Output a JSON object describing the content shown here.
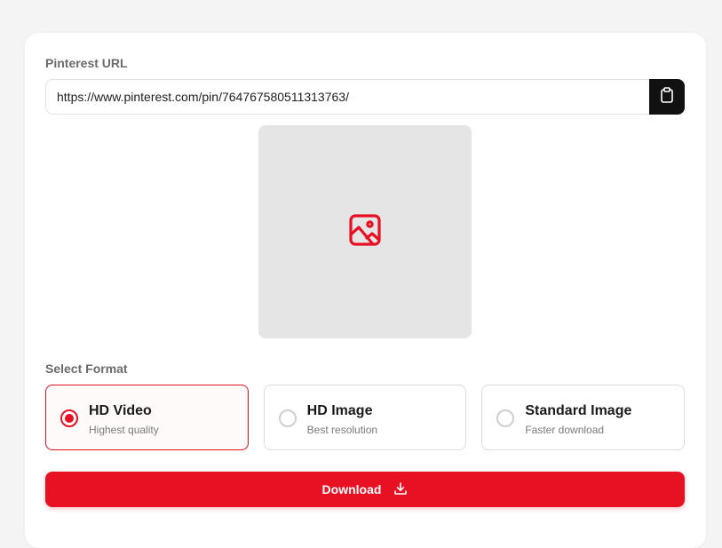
{
  "form": {
    "url_label": "Pinterest URL",
    "url_value": "https://www.pinterest.com/pin/764767580511313763/",
    "paste_icon": "clipboard-icon",
    "preview_icon": "image-icon",
    "format_label": "Select Format",
    "options": [
      {
        "title": "HD Video",
        "subtitle": "Highest quality",
        "selected": true
      },
      {
        "title": "HD Image",
        "subtitle": "Best resolution",
        "selected": false
      },
      {
        "title": "Standard Image",
        "subtitle": "Faster download",
        "selected": false
      }
    ],
    "download_label": "Download",
    "download_icon": "download-icon"
  },
  "colors": {
    "accent": "#e81123",
    "background": "#f4f4f4",
    "card": "#ffffff",
    "paste_button": "#111111",
    "preview_bg": "#e5e5e5"
  }
}
